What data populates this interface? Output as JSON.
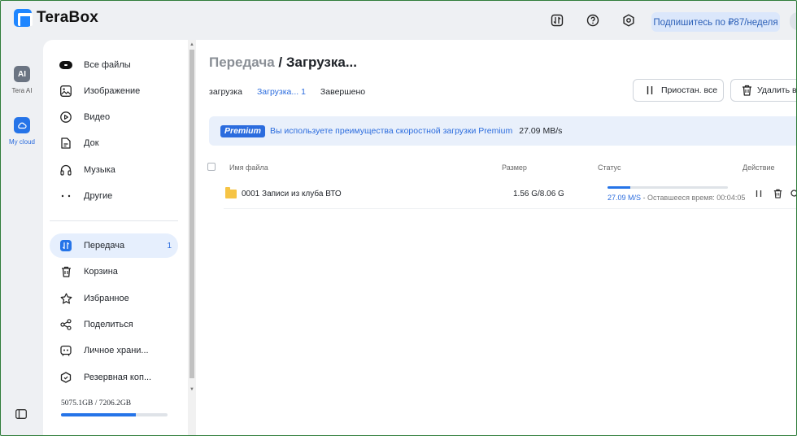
{
  "app": {
    "name": "TeraBox"
  },
  "header": {
    "subscribe_label": "Подпишитесь по ₽87/неделя"
  },
  "rail": {
    "ai_icon_text": "AI",
    "ai_label": "Tera AI",
    "cloud_label": "My cloud"
  },
  "sidebar": {
    "items": [
      {
        "label": "Все файлы",
        "icon": "all-files-icon"
      },
      {
        "label": "Изображение",
        "icon": "image-icon"
      },
      {
        "label": "Видео",
        "icon": "video-icon"
      },
      {
        "label": "Док",
        "icon": "document-icon"
      },
      {
        "label": "Музыка",
        "icon": "headphones-icon"
      },
      {
        "label": "Другие",
        "icon": "more-dots-icon"
      }
    ],
    "items2": [
      {
        "label": "Передача",
        "icon": "transfer-icon",
        "badge": "1"
      },
      {
        "label": "Корзина",
        "icon": "trash-icon"
      },
      {
        "label": "Избранное",
        "icon": "star-icon"
      },
      {
        "label": "Поделиться",
        "icon": "share-icon"
      },
      {
        "label": "Личное храни...",
        "icon": "vault-icon"
      },
      {
        "label": "Резервная коп...",
        "icon": "backup-icon"
      }
    ],
    "storage_text": "5075.1GB / 7206.2GB",
    "storage_fraction": 0.704
  },
  "main": {
    "breadcrumb_parent": "Передача",
    "breadcrumb_sep": " / ",
    "breadcrumb_current": "Загрузка...",
    "tabs": [
      {
        "label": "загрузка"
      },
      {
        "label": "Загрузка... 1"
      },
      {
        "label": "Завершено"
      }
    ],
    "pause_all_label": "Приостан. все",
    "delete_all_label": "Удалить вс",
    "premium": {
      "badge": "Premium",
      "text": "Вы используете преимущества скоростной загрузки Premium",
      "speed": "27.09 MB/s"
    },
    "table": {
      "headers": {
        "name": "Имя файла",
        "size": "Размер",
        "status": "Статус",
        "action": "Действие"
      },
      "rows": [
        {
          "name": "0001 Записи из клуба ВТО",
          "size": "1.56 G/8.06 G",
          "progress": 0.19,
          "speed": "27.09 M/S",
          "remaining": " - Оставшееся время: 00:04:05"
        }
      ]
    }
  },
  "colors": {
    "accent": "#2574e8",
    "folder": "#f6c445",
    "premium_bg": "#e9f0fb"
  }
}
